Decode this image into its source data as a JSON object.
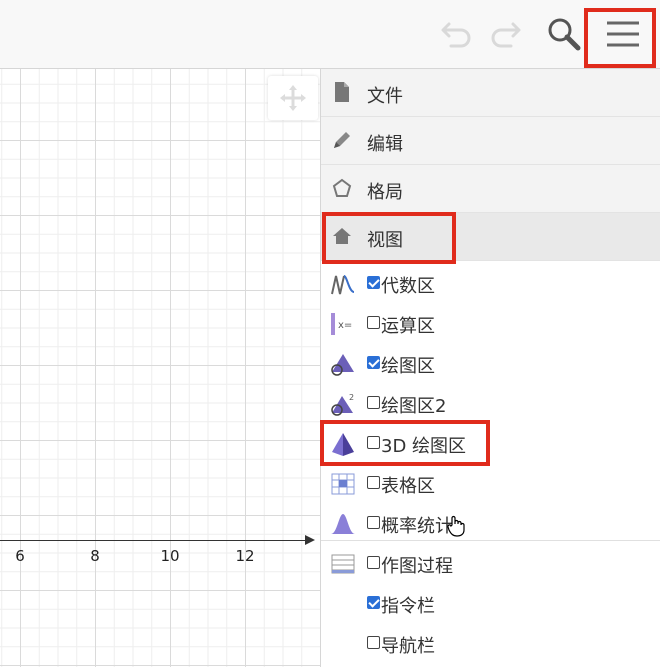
{
  "toolbar": {
    "icons": [
      "undo-icon",
      "redo-icon",
      "search-icon",
      "menu-icon"
    ],
    "highlight_color": "#e02b1c"
  },
  "graphics": {
    "x_ticks": [
      "6",
      "8",
      "10",
      "12"
    ]
  },
  "menu": {
    "items": [
      {
        "label": "文件",
        "icon": "file-icon"
      },
      {
        "label": "编辑",
        "icon": "pencil-icon"
      },
      {
        "label": "格局",
        "icon": "pentagon-icon"
      },
      {
        "label": "视图",
        "icon": "home-icon",
        "active": true
      }
    ],
    "view_items": [
      {
        "label": "代数区",
        "checked": true,
        "icon": "algebra-icon"
      },
      {
        "label": "运算区",
        "checked": false,
        "icon": "cas-icon"
      },
      {
        "label": "绘图区",
        "checked": true,
        "icon": "graphics-icon"
      },
      {
        "label": "绘图区2",
        "checked": false,
        "icon": "graphics2-icon"
      },
      {
        "label": "3D 绘图区",
        "checked": false,
        "icon": "graphics-3d-icon"
      },
      {
        "label": "表格区",
        "checked": false,
        "icon": "spreadsheet-icon"
      },
      {
        "label": "概率统计",
        "checked": false,
        "icon": "probability-icon"
      },
      {
        "label": "作图过程",
        "checked": false,
        "icon": "construction-protocol-icon"
      },
      {
        "label": "指令栏",
        "checked": true
      },
      {
        "label": "导航栏",
        "checked": false
      }
    ]
  }
}
